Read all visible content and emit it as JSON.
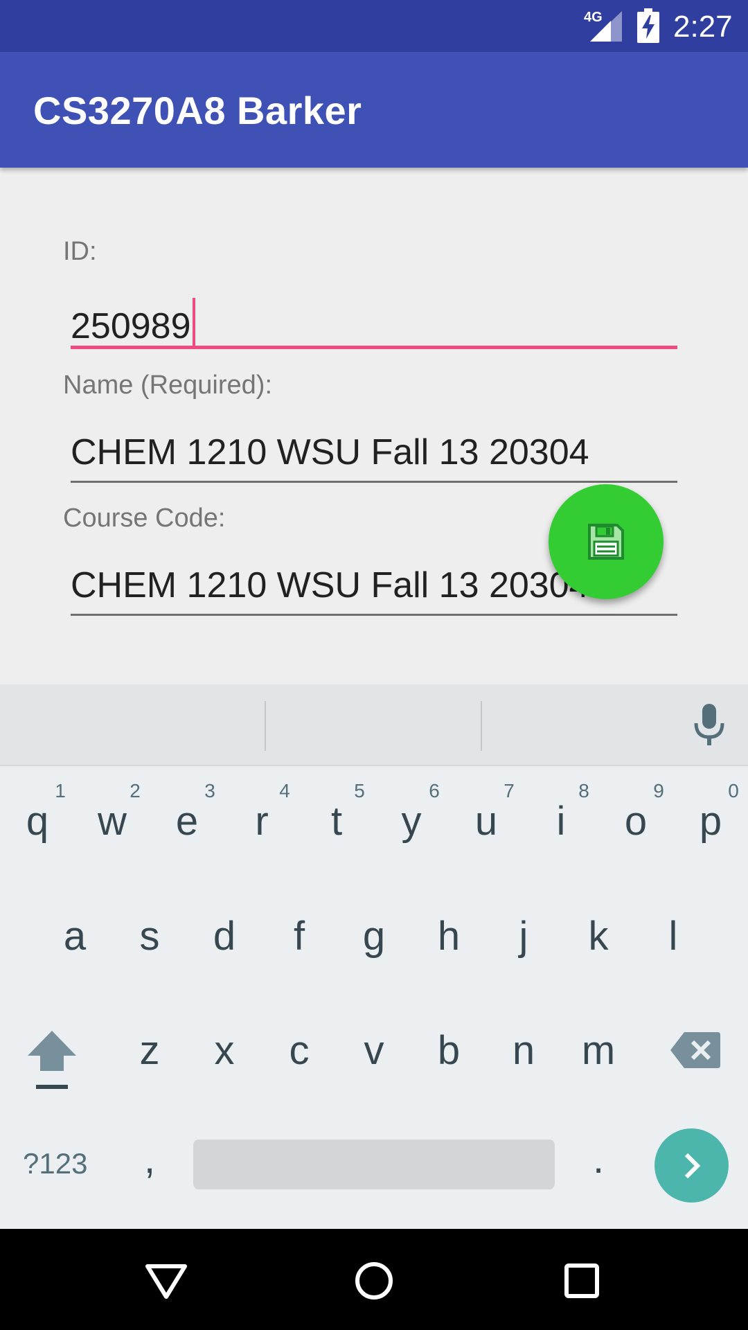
{
  "status_bar": {
    "network": "4G",
    "time": "2:27",
    "icons": [
      "signal-icon",
      "battery-charging-icon"
    ]
  },
  "app_bar": {
    "title": "CS3270A8 Barker"
  },
  "form": {
    "id_label": "ID:",
    "id_value": "250989",
    "name_label": "Name (Required):",
    "name_value": "CHEM 1210 WSU Fall 13 20304",
    "course_code_label": "Course Code:",
    "course_code_value": "CHEM 1210 WSU Fall 13 20304"
  },
  "fab": {
    "icon": "save-icon",
    "color": "#33cc33"
  },
  "keyboard": {
    "row1": [
      "q",
      "w",
      "e",
      "r",
      "t",
      "y",
      "u",
      "i",
      "o",
      "p"
    ],
    "row1_hints": [
      "1",
      "2",
      "3",
      "4",
      "5",
      "6",
      "7",
      "8",
      "9",
      "0"
    ],
    "row2": [
      "a",
      "s",
      "d",
      "f",
      "g",
      "h",
      "j",
      "k",
      "l"
    ],
    "row3": [
      "z",
      "x",
      "c",
      "v",
      "b",
      "n",
      "m"
    ],
    "symbols_key": "?123",
    "comma_key": ",",
    "period_key": ".",
    "icons": [
      "mic-icon",
      "shift-icon",
      "backspace-icon",
      "enter-arrow-icon"
    ]
  },
  "nav_bar": {
    "icons": [
      "back-icon",
      "home-icon",
      "recents-icon"
    ]
  },
  "colors": {
    "status_bar": "#303f9f",
    "app_bar": "#3f51b5",
    "accent": "#ef4a81",
    "enter_key": "#4db6ac"
  }
}
